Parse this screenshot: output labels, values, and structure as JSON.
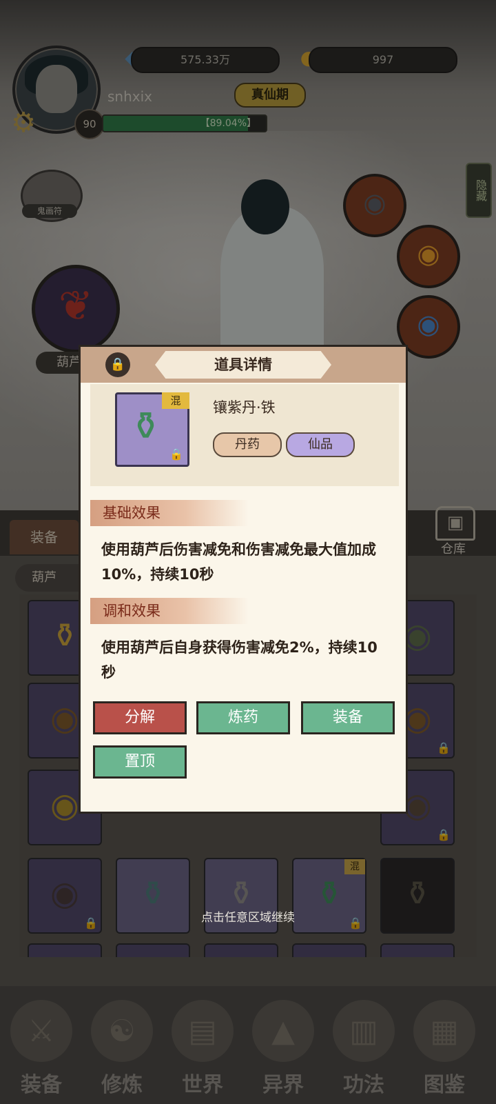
{
  "header": {
    "username": "snhxix",
    "level": "90",
    "xp_percent": 89.04,
    "xp_text": "【89.04%】",
    "realm": "真仙期",
    "spirit_stones": "575.33万",
    "gold": "997",
    "hide_label": "隐藏",
    "ghost_label": "鬼画符",
    "gourd_label": "葫芦"
  },
  "inventory": {
    "tab_equip": "装备",
    "filter_label": "葫芦",
    "warehouse_label": "仓库",
    "continue_hint": "点击任意区域继续"
  },
  "nav": [
    {
      "label": "装备"
    },
    {
      "label": "修炼"
    },
    {
      "label": "世界"
    },
    {
      "label": "异界"
    },
    {
      "label": "功法"
    },
    {
      "label": "图鉴"
    }
  ],
  "modal": {
    "title": "道具详情",
    "item_name": "镶紫丹·铁",
    "item_tag": "混",
    "category": "丹药",
    "grade": "仙品",
    "base_effect_title": "基础效果",
    "base_effect_text": "使用葫芦后伤害减免和伤害减免最大值加成10%，持续10秒",
    "harmony_effect_title": "调和效果",
    "harmony_effect_text": "使用葫芦后自身获得伤害减免2%，持续10秒",
    "buttons": {
      "decompose": "分解",
      "refine": "炼药",
      "equip": "装备",
      "pin": "置顶"
    }
  },
  "colors": {
    "modal_bg": "#fbf6ea",
    "header_band": "#c8a68b",
    "button_red": "#b9514a",
    "button_green": "#6bb690",
    "pill_category": "#e7c7a9",
    "pill_grade": "#b8a8e2"
  }
}
